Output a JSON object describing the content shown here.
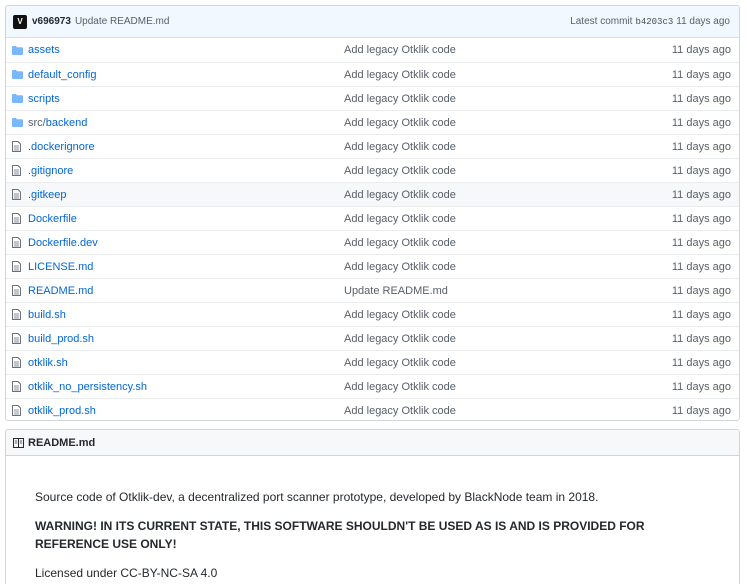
{
  "commit": {
    "avatar_letter": "V",
    "author": "v696973",
    "message": "Update README.md",
    "latest_label": "Latest commit",
    "sha": "b4203c3",
    "age": "11 days ago"
  },
  "files": [
    {
      "type": "folder",
      "prefix": "",
      "name": "assets",
      "message": "Add legacy Otklik code",
      "age": "11 days ago"
    },
    {
      "type": "folder",
      "prefix": "",
      "name": "default_config",
      "message": "Add legacy Otklik code",
      "age": "11 days ago"
    },
    {
      "type": "folder",
      "prefix": "",
      "name": "scripts",
      "message": "Add legacy Otklik code",
      "age": "11 days ago"
    },
    {
      "type": "folder",
      "prefix": "src/",
      "name": "backend",
      "message": "Add legacy Otklik code",
      "age": "11 days ago"
    },
    {
      "type": "file",
      "prefix": "",
      "name": ".dockerignore",
      "message": "Add legacy Otklik code",
      "age": "11 days ago"
    },
    {
      "type": "file",
      "prefix": "",
      "name": ".gitignore",
      "message": "Add legacy Otklik code",
      "age": "11 days ago"
    },
    {
      "type": "file",
      "prefix": "",
      "name": ".gitkeep",
      "message": "Add legacy Otklik code",
      "age": "11 days ago"
    },
    {
      "type": "file",
      "prefix": "",
      "name": "Dockerfile",
      "message": "Add legacy Otklik code",
      "age": "11 days ago"
    },
    {
      "type": "file",
      "prefix": "",
      "name": "Dockerfile.dev",
      "message": "Add legacy Otklik code",
      "age": "11 days ago"
    },
    {
      "type": "file",
      "prefix": "",
      "name": "LICENSE.md",
      "message": "Add legacy Otklik code",
      "age": "11 days ago"
    },
    {
      "type": "file",
      "prefix": "",
      "name": "README.md",
      "message": "Update README.md",
      "age": "11 days ago"
    },
    {
      "type": "file",
      "prefix": "",
      "name": "build.sh",
      "message": "Add legacy Otklik code",
      "age": "11 days ago"
    },
    {
      "type": "file",
      "prefix": "",
      "name": "build_prod.sh",
      "message": "Add legacy Otklik code",
      "age": "11 days ago"
    },
    {
      "type": "file",
      "prefix": "",
      "name": "otklik.sh",
      "message": "Add legacy Otklik code",
      "age": "11 days ago"
    },
    {
      "type": "file",
      "prefix": "",
      "name": "otklik_no_persistency.sh",
      "message": "Add legacy Otklik code",
      "age": "11 days ago"
    },
    {
      "type": "file",
      "prefix": "",
      "name": "otklik_prod.sh",
      "message": "Add legacy Otklik code",
      "age": "11 days ago"
    }
  ],
  "highlighted_row": ".gitkeep",
  "readme": {
    "title": "README.md",
    "icon": "book-icon",
    "paragraph1": "Source code of Otklik-dev, a decentralized port scanner prototype, developed by BlackNode team in 2018.",
    "warning": "WARNING! IN ITS CURRENT STATE, THIS SOFTWARE SHOULDN'T BE USED AS IS AND IS PROVIDED FOR REFERENCE USE ONLY!",
    "license": "Licensed under CC-BY-NC-SA 4.0"
  },
  "colors": {
    "link": "#0366d6",
    "muted": "#586069",
    "folder_icon": "#79b8ff",
    "commit_bar_bg": "#f1f8ff"
  }
}
